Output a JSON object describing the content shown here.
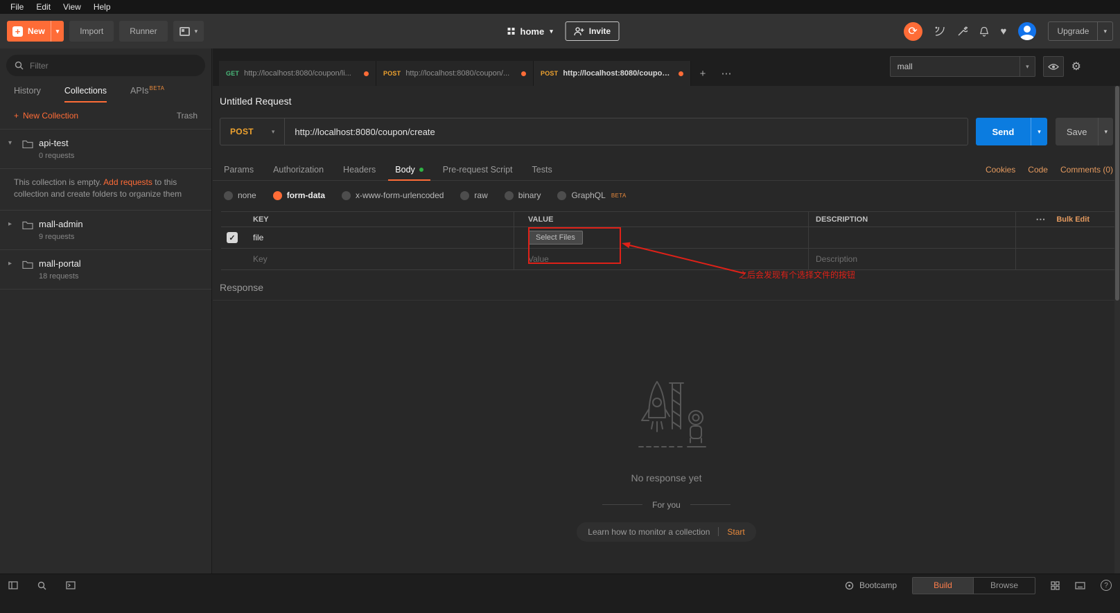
{
  "menu": {
    "items": [
      "File",
      "Edit",
      "View",
      "Help"
    ]
  },
  "toolbar": {
    "new": "New",
    "import": "Import",
    "runner": "Runner",
    "workspace_name": "home",
    "invite": "Invite",
    "upgrade": "Upgrade"
  },
  "sidebar": {
    "filter_placeholder": "Filter",
    "tabs": {
      "history": "History",
      "collections": "Collections",
      "apis": "APIs"
    },
    "apis_badge": "BETA",
    "new_collection": "New Collection",
    "trash": "Trash",
    "collections": [
      {
        "name": "api-test",
        "count": "0 requests"
      },
      {
        "name": "mall-admin",
        "count": "9 requests"
      },
      {
        "name": "mall-portal",
        "count": "18 requests"
      }
    ],
    "empty": {
      "pre": "This collection is empty. ",
      "link": "Add requests",
      "post": " to this collection and create folders to organize them"
    }
  },
  "tabstrip": {
    "tabs": [
      {
        "method": "GET",
        "url": "http://localhost:8080/coupon/li..."
      },
      {
        "method": "POST",
        "url": "http://localhost:8080/coupon/..."
      },
      {
        "method": "POST",
        "url": "http://localhost:8080/coupon/..."
      }
    ],
    "environment": "mall"
  },
  "request": {
    "title": "Untitled Request",
    "method": "POST",
    "url": "http://localhost:8080/coupon/create",
    "send": "Send",
    "save": "Save",
    "tabs": [
      "Params",
      "Authorization",
      "Headers",
      "Body",
      "Pre-request Script",
      "Tests"
    ],
    "links": {
      "cookies": "Cookies",
      "code": "Code",
      "comments": "Comments (0)"
    },
    "body_modes": [
      "none",
      "form-data",
      "x-www-form-urlencoded",
      "raw",
      "binary",
      "GraphQL"
    ],
    "graphql_badge": "BETA",
    "table": {
      "col_key": "KEY",
      "col_value": "VALUE",
      "col_desc": "DESCRIPTION",
      "bulk_edit": "Bulk Edit",
      "row": {
        "key": "file",
        "select_files": "Select Files"
      },
      "ph_key": "Key",
      "ph_value": "Value",
      "ph_desc": "Description"
    }
  },
  "annotation": {
    "text": "之后会发现有个选择文件的按钮"
  },
  "response": {
    "title": "Response",
    "empty": "No response yet",
    "for_you": "For you",
    "learn": "Learn how to monitor a collection",
    "start": "Start"
  },
  "statusbar": {
    "bootcamp": "Bootcamp",
    "build": "Build",
    "browse": "Browse"
  },
  "icons": {
    "check": "✓",
    "caret_down": "▾",
    "caret_right": "▸",
    "plus": "+",
    "ellipsis": "⋯",
    "heart": "♥",
    "sync": "⟳",
    "gear": "⚙",
    "help": "?"
  },
  "colors": {
    "accent": "#ff6c37",
    "send_blue": "#0b7ce0",
    "get_green": "#49b97a",
    "post_orange": "#efa32f",
    "annotation_red": "#df2118"
  }
}
